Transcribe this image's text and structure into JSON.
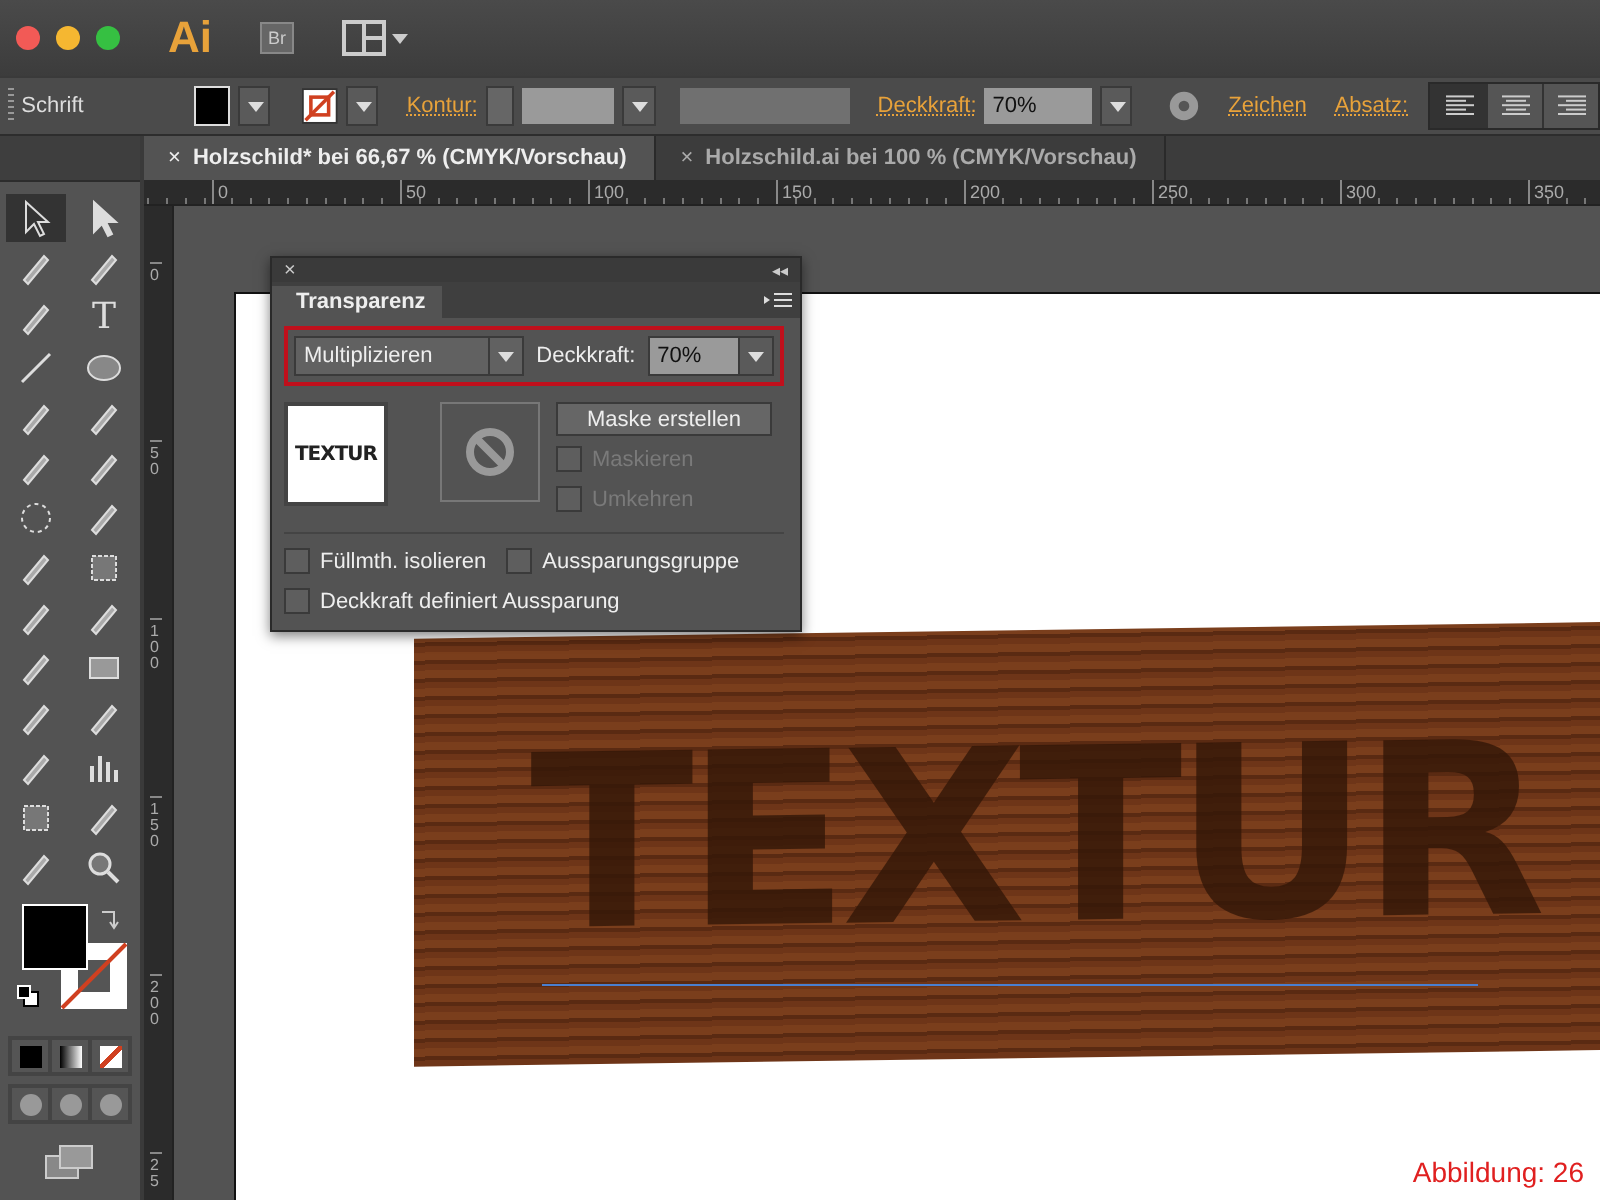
{
  "app": {
    "logo": "Ai",
    "bridge": "Br"
  },
  "control_bar": {
    "label": "Schrift",
    "stroke_label": "Kontur:",
    "opacity_label": "Deckkraft:",
    "opacity": "70%",
    "char_link": "Zeichen",
    "para_link": "Absatz:",
    "align": [
      {
        "kind": "left",
        "selected": true
      },
      {
        "kind": "center",
        "selected": false
      },
      {
        "kind": "right",
        "selected": false
      }
    ]
  },
  "tabs": [
    {
      "label": "Holzschild* bei 66,67 % (CMYK/Vorschau)",
      "close": "×",
      "selected": true
    },
    {
      "label": "Holzschild.ai bei 100 % (CMYK/Vorschau)",
      "close": "×",
      "selected": false
    }
  ],
  "tools": [
    {
      "kind": "select",
      "selected": true
    },
    {
      "kind": "direct",
      "selected": false
    },
    {
      "kind": "wand",
      "selected": false
    },
    {
      "kind": "lasso",
      "selected": false
    },
    {
      "kind": "pen",
      "selected": false
    },
    {
      "kind": "type",
      "glyph": "T",
      "selected": false
    },
    {
      "kind": "line",
      "selected": false
    },
    {
      "kind": "ellipse",
      "selected": false
    },
    {
      "kind": "brush",
      "selected": false
    },
    {
      "kind": "pencil",
      "selected": false
    },
    {
      "kind": "blob",
      "selected": false
    },
    {
      "kind": "eraser",
      "selected": false
    },
    {
      "kind": "rotate",
      "selected": false
    },
    {
      "kind": "scale",
      "selected": false
    },
    {
      "kind": "warp",
      "selected": false
    },
    {
      "kind": "transform",
      "selected": false
    },
    {
      "kind": "builder",
      "selected": false
    },
    {
      "kind": "grid",
      "selected": false
    },
    {
      "kind": "mesh",
      "selected": false
    },
    {
      "kind": "gradient",
      "selected": false
    },
    {
      "kind": "eyedropper",
      "selected": false
    },
    {
      "kind": "blend",
      "selected": false
    },
    {
      "kind": "spray",
      "selected": false
    },
    {
      "kind": "graph",
      "selected": false
    },
    {
      "kind": "artboard",
      "selected": false
    },
    {
      "kind": "slice",
      "selected": false
    },
    {
      "kind": "hand",
      "selected": false
    },
    {
      "kind": "zoom",
      "selected": false
    }
  ],
  "ruler": {
    "horizontal": [
      "0",
      "50",
      "100",
      "150",
      "200",
      "250",
      "300",
      "350"
    ],
    "vertical": [
      "0",
      "50",
      "100",
      "150",
      "200",
      "25"
    ]
  },
  "panel": {
    "close": "×",
    "collapse": "◂◂",
    "title": "Transparenz",
    "blend_mode": "Multiplizieren",
    "opacity_label": "Deckkraft:",
    "opacity": "70%",
    "thumbnail_text": "TEXTUR",
    "mask_button": "Maske erstellen",
    "mask_options": [
      {
        "label": "Maskieren",
        "checked": false,
        "disabled": true
      },
      {
        "label": "Umkehren",
        "checked": false,
        "disabled": true
      }
    ],
    "options": [
      {
        "label": "Füllmth. isolieren",
        "checked": false
      },
      {
        "label": "Aussparungsgruppe",
        "checked": false
      },
      {
        "label": "Deckkraft definiert Aussparung",
        "checked": false
      }
    ]
  },
  "artwork": {
    "text": "TEXTUR"
  },
  "caption": "Abbildung: 26"
}
